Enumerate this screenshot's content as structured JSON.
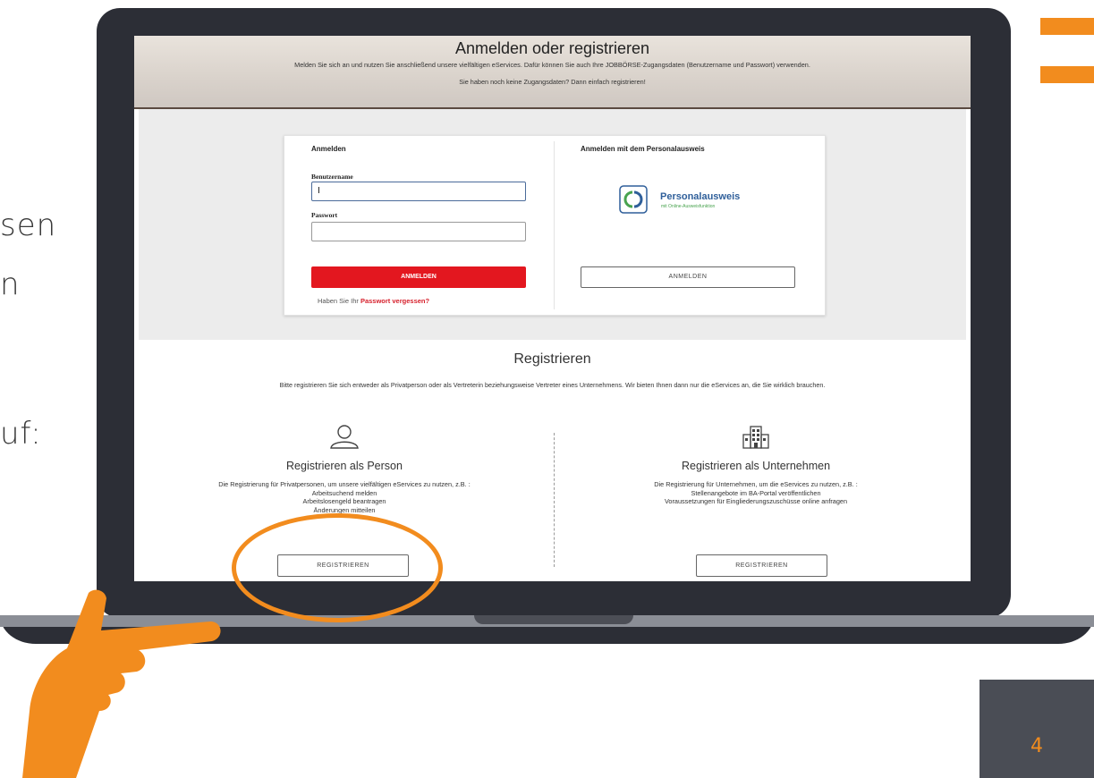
{
  "slide": {
    "fragment_1": "sen",
    "fragment_2": "n",
    "fragment_3": "uf:",
    "page_number": "4"
  },
  "hero": {
    "title": "Anmelden oder registrieren",
    "subtitle_1": "Melden Sie sich an und nutzen Sie anschließend unsere vielfältigen eServices. Dafür können Sie auch Ihre JOBBÖRSE-Zugangsdaten (Benutzername und Passwort) verwenden.",
    "subtitle_2": "Sie haben noch keine Zugangsdaten? Dann einfach registrieren!"
  },
  "login": {
    "heading": "Anmelden",
    "username_label": "Benutzername",
    "username_value": "I",
    "password_label": "Passwort",
    "password_value": "",
    "submit_label": "ANMELDEN",
    "forgot_prefix": "Haben Sie Ihr ",
    "forgot_link": "Passwort vergessen?"
  },
  "id_login": {
    "heading": "Anmelden mit dem Personalausweis",
    "logo_text": "Personalausweis",
    "logo_sub": "mit Online-Ausweisfunktion",
    "submit_label": "ANMELDEN"
  },
  "register": {
    "title": "Registrieren",
    "subtitle": "Bitte registrieren Sie sich entweder als Privatperson oder als Vertreterin beziehungsweise Vertreter eines Unternehmens. Wir bieten Ihnen dann nur die eServices an, die Sie wirklich brauchen.",
    "person": {
      "heading": "Registrieren als Person",
      "intro": "Die Registrierung für Privatpersonen, um unsere vielfältigen eServices zu nutzen, z.B. :",
      "items": [
        "Arbeitsuchend melden",
        "Arbeitslosengeld beantragen",
        "Änderungen mitteilen"
      ],
      "button": "REGISTRIEREN"
    },
    "company": {
      "heading": "Registrieren als Unternehmen",
      "intro": "Die Registrierung für Unternehmen, um die eServices zu nutzen, z.B. :",
      "items": [
        "Stellenangebote im BA-Portal veröffentlichen",
        "Voraussetzungen für Eingliederungszuschüsse online anfragen"
      ],
      "button": "REGISTRIEREN"
    }
  },
  "colors": {
    "accent_orange": "#f28c1e",
    "laptop": "#2c2e36",
    "primary_red": "#e3171f",
    "link_red": "#d61f2b"
  }
}
